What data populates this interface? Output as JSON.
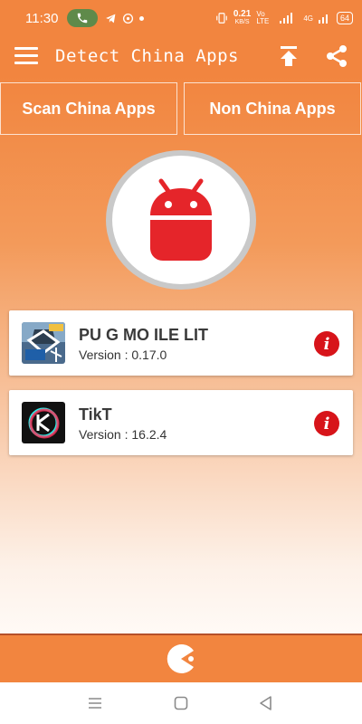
{
  "status_bar": {
    "time": "11:30",
    "net_speed": "0.21",
    "net_unit": "KB/S",
    "volte": "Vo LTE",
    "signal_label": "4G",
    "battery": "64"
  },
  "app_bar": {
    "title": "Detect China Apps",
    "color": "#f2853f"
  },
  "tabs": [
    {
      "label": "Scan China Apps"
    },
    {
      "label": "Non China Apps"
    }
  ],
  "apps": [
    {
      "name": "PU  G MO  ILE LIT",
      "version": "Version : 0.17.0",
      "icon": "pubg-mobile-lite-icon"
    },
    {
      "name": "TikT",
      "version": "Version : 16.2.4",
      "icon": "tiktok-icon"
    }
  ],
  "info_symbol": "i",
  "colors": {
    "accent": "#f2853f",
    "android": "#e5252a",
    "info": "#d7141a"
  },
  "icons": {
    "menu": "menu-icon",
    "upload": "upload-icon",
    "share": "share-icon",
    "scan": "android-icon",
    "bottom": "pacman-icon"
  }
}
